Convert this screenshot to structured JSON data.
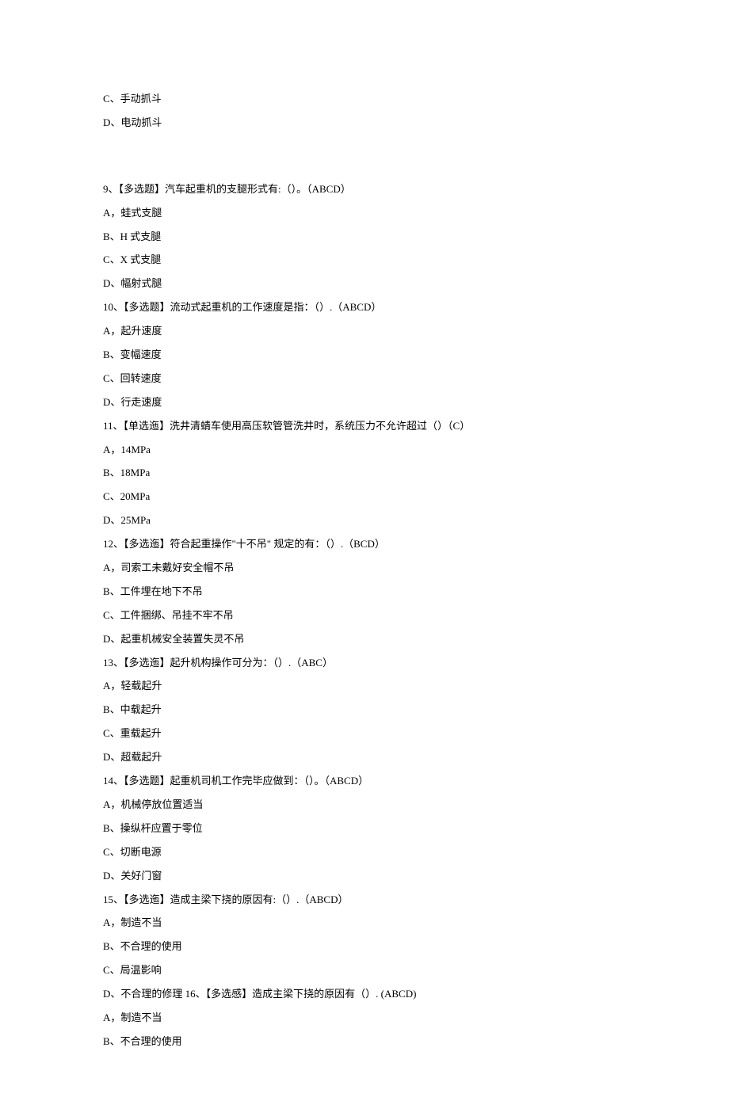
{
  "q8": {
    "optC": "C、手动抓斗",
    "optD": "D、电动抓斗"
  },
  "q9": {
    "stem": "9、【多选题】汽车起重机的支腿形式有:（）。（ABCD）",
    "optA": "A，蛙式支腿",
    "optB": "B、H 式支腿",
    "optC": "C、X 式支腿",
    "optD": "D、幅射式腿"
  },
  "q10": {
    "stem": "10、【多选题】流动式起重机的工作速度是指：（）.（ABCD）",
    "optA": "A，起升速度",
    "optB": "B、变幅速度",
    "optC": "C、回转速度",
    "optD": "D、行走速度"
  },
  "q11": {
    "stem": "11、【单选迤】洗井清蜻车使用高压软管管洗井时，系统压力不允许超过（）（C）",
    "optA": "A，14MPa",
    "optB": "B、18MPa",
    "optC": "C、20MPa",
    "optD": "D、25MPa"
  },
  "q12": {
    "stem": "12、【多选迤】符合起重操作\"十不吊\" 规定的有：（）.（BCD）",
    "optA": "A，司索工未戴好安全帽不吊",
    "optB": "B、工件埋在地下不吊",
    "optC": "C、工件捆绑、吊挂不牢不吊",
    "optD": "D、起重机械安全装置失灵不吊"
  },
  "q13": {
    "stem": "13、【多选迤】起升机构操作可分为：（）.（ABC）",
    "optA": "A，轻载起升",
    "optB": "B、中载起升",
    "optC": "C、重载起升",
    "optD": "D、超载起升"
  },
  "q14": {
    "stem": "14、【多选题】起重机司机工作完毕应做到：（）。（ABCD）",
    "optA": "A，机械停放位置适当",
    "optB": "B、操纵杆应置于零位",
    "optC": "C、切断电源",
    "optD": "D、关好门窗"
  },
  "q15": {
    "stem": "15、【多选迤】造成主梁下挠的原因有:（）.（ABCD）",
    "optA": "A，制造不当",
    "optB": "B、不合理的使用",
    "optC": "C、局温影响",
    "optD": "D、不合理的修理 16、【多选感】造成主梁下挠的原因有（）. (ABCD)"
  },
  "q16": {
    "optA": "A，制造不当",
    "optB": "B、不合理的使用"
  }
}
